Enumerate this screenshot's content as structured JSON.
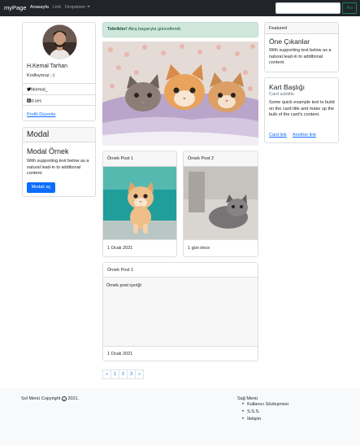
{
  "navbar": {
    "brand": "myPage",
    "links": [
      "Anasayfa",
      "Link",
      "Dropdown"
    ],
    "search_placeholder": "",
    "search_button": "Ara"
  },
  "profile": {
    "name": "H.Kemal Tarhan",
    "subtitle": "Kodluyoruz ;-)",
    "twitter": "hkemal_",
    "instagram": "d-sec",
    "edit_link": "Profili Düzenle"
  },
  "modal_card": {
    "header": "Modal",
    "title": "Modal Örnek",
    "text": "With supporting text below as a natural lead-in to additional content.",
    "button": "Modalı aç"
  },
  "alert": {
    "strong": "Tebrikler!",
    "text": " Akış başarıyla güncellendi."
  },
  "posts": [
    {
      "header": "Örnek Post 1",
      "footer": "1 Ocak 2021"
    },
    {
      "header": "Örnek Post 2",
      "footer": "1 gün önce"
    }
  ],
  "text_post": {
    "header": "Örnek Post 1",
    "body": "Örnek post içeriği",
    "footer": "1 Ocak 2021"
  },
  "pagination": [
    "«",
    "1",
    "2",
    "3",
    "»"
  ],
  "featured": {
    "header": "Featured",
    "title": "Öne Çıkanlar",
    "text": "With supporting text below as a natural lead-in to additional content."
  },
  "kart": {
    "title": "Kart Başlığı",
    "subtitle": "Card subtitle",
    "text": "Some quick example text to build on the card title and make up the bulk of the card's content.",
    "link1": "Card link",
    "link2": "Another link"
  },
  "footer": {
    "left_pre": "Sol Menü Copyright",
    "left_post": "2021.",
    "right_title": "Sağ Menü",
    "right_items": [
      "Kullanıcı Sözleşmesi",
      "S.S.S.",
      "İletişim"
    ]
  },
  "colors": {
    "navbar": "#212529",
    "primary": "#0d6efd",
    "success": "#198754",
    "alert_bg": "#d1e7dd",
    "alert_text": "#0f5132"
  }
}
